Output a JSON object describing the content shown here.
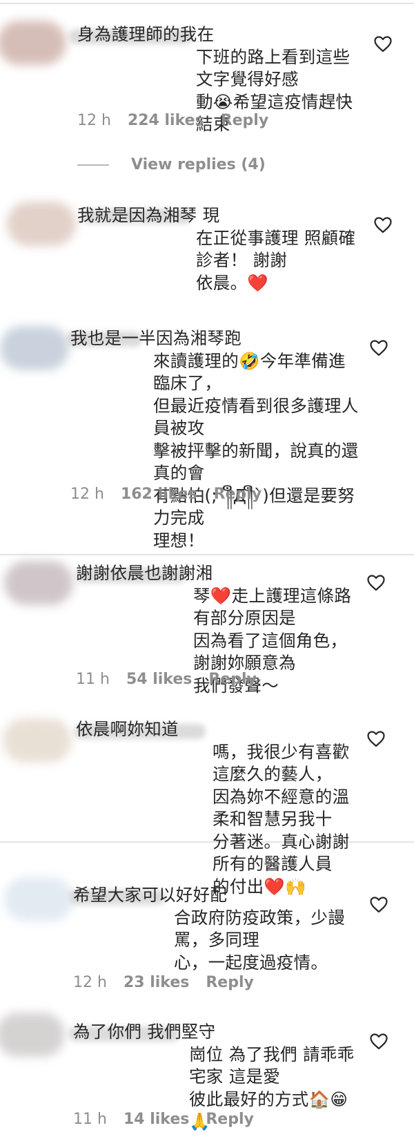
{
  "comments": [
    {
      "text": "身為護理師的我在\n下班的路上看到這些文字覺得好感\n動😭希望這疫情趕快結束",
      "time": "12 h",
      "likes": "224 likes",
      "reply": "Reply"
    },
    {
      "text": "我就是因為湘琴 現\n在正從事護理 照顧確診者！ 謝謝\n依晨。❤️",
      "time": "",
      "likes": "",
      "reply": ""
    },
    {
      "text": "我也是一半因為湘琴跑\n來讀護理的🤣今年準備進臨床了，\n但最近疫情看到很多護理人員被攻\n擊被抨擊的新聞，說真的還真的會\n有點怕(;´༎ຶД༎ຶ`)但還是要努力完成\n理想！",
      "time": "12 h",
      "likes": "162 likes",
      "reply": "Reply"
    },
    {
      "text": "謝謝依晨也謝謝湘\n琴❤️走上護理這條路有部分原因是\n因為看了這個角色，謝謝妳願意為\n我們發聲～",
      "time": "11 h",
      "likes": "54 likes",
      "reply": "Reply"
    },
    {
      "text": "依晨啊妳知道\n嗎，我很少有喜歡這麼久的藝人，\n因為妳不經意的溫柔和智慧另我十\n分著迷。真心謝謝所有的醫護人員\n的付出❤️🙌",
      "time": "",
      "likes": "",
      "reply": ""
    },
    {
      "text": "希望大家可以好好配\n合政府防疫政策，少謾罵，多同理\n心，一起度過疫情。",
      "time": "12 h",
      "likes": "23 likes",
      "reply": "Reply"
    },
    {
      "text": "為了你們 我們堅守\n崗位 為了我們 請乖乖宅家 這是愛\n彼此最好的方式🏠😁🙏",
      "time": "11 h",
      "likes": "14 likes",
      "reply": "Reply"
    }
  ],
  "view_replies": "View replies (4)",
  "icons": {
    "heart": "heart-outline-icon"
  }
}
